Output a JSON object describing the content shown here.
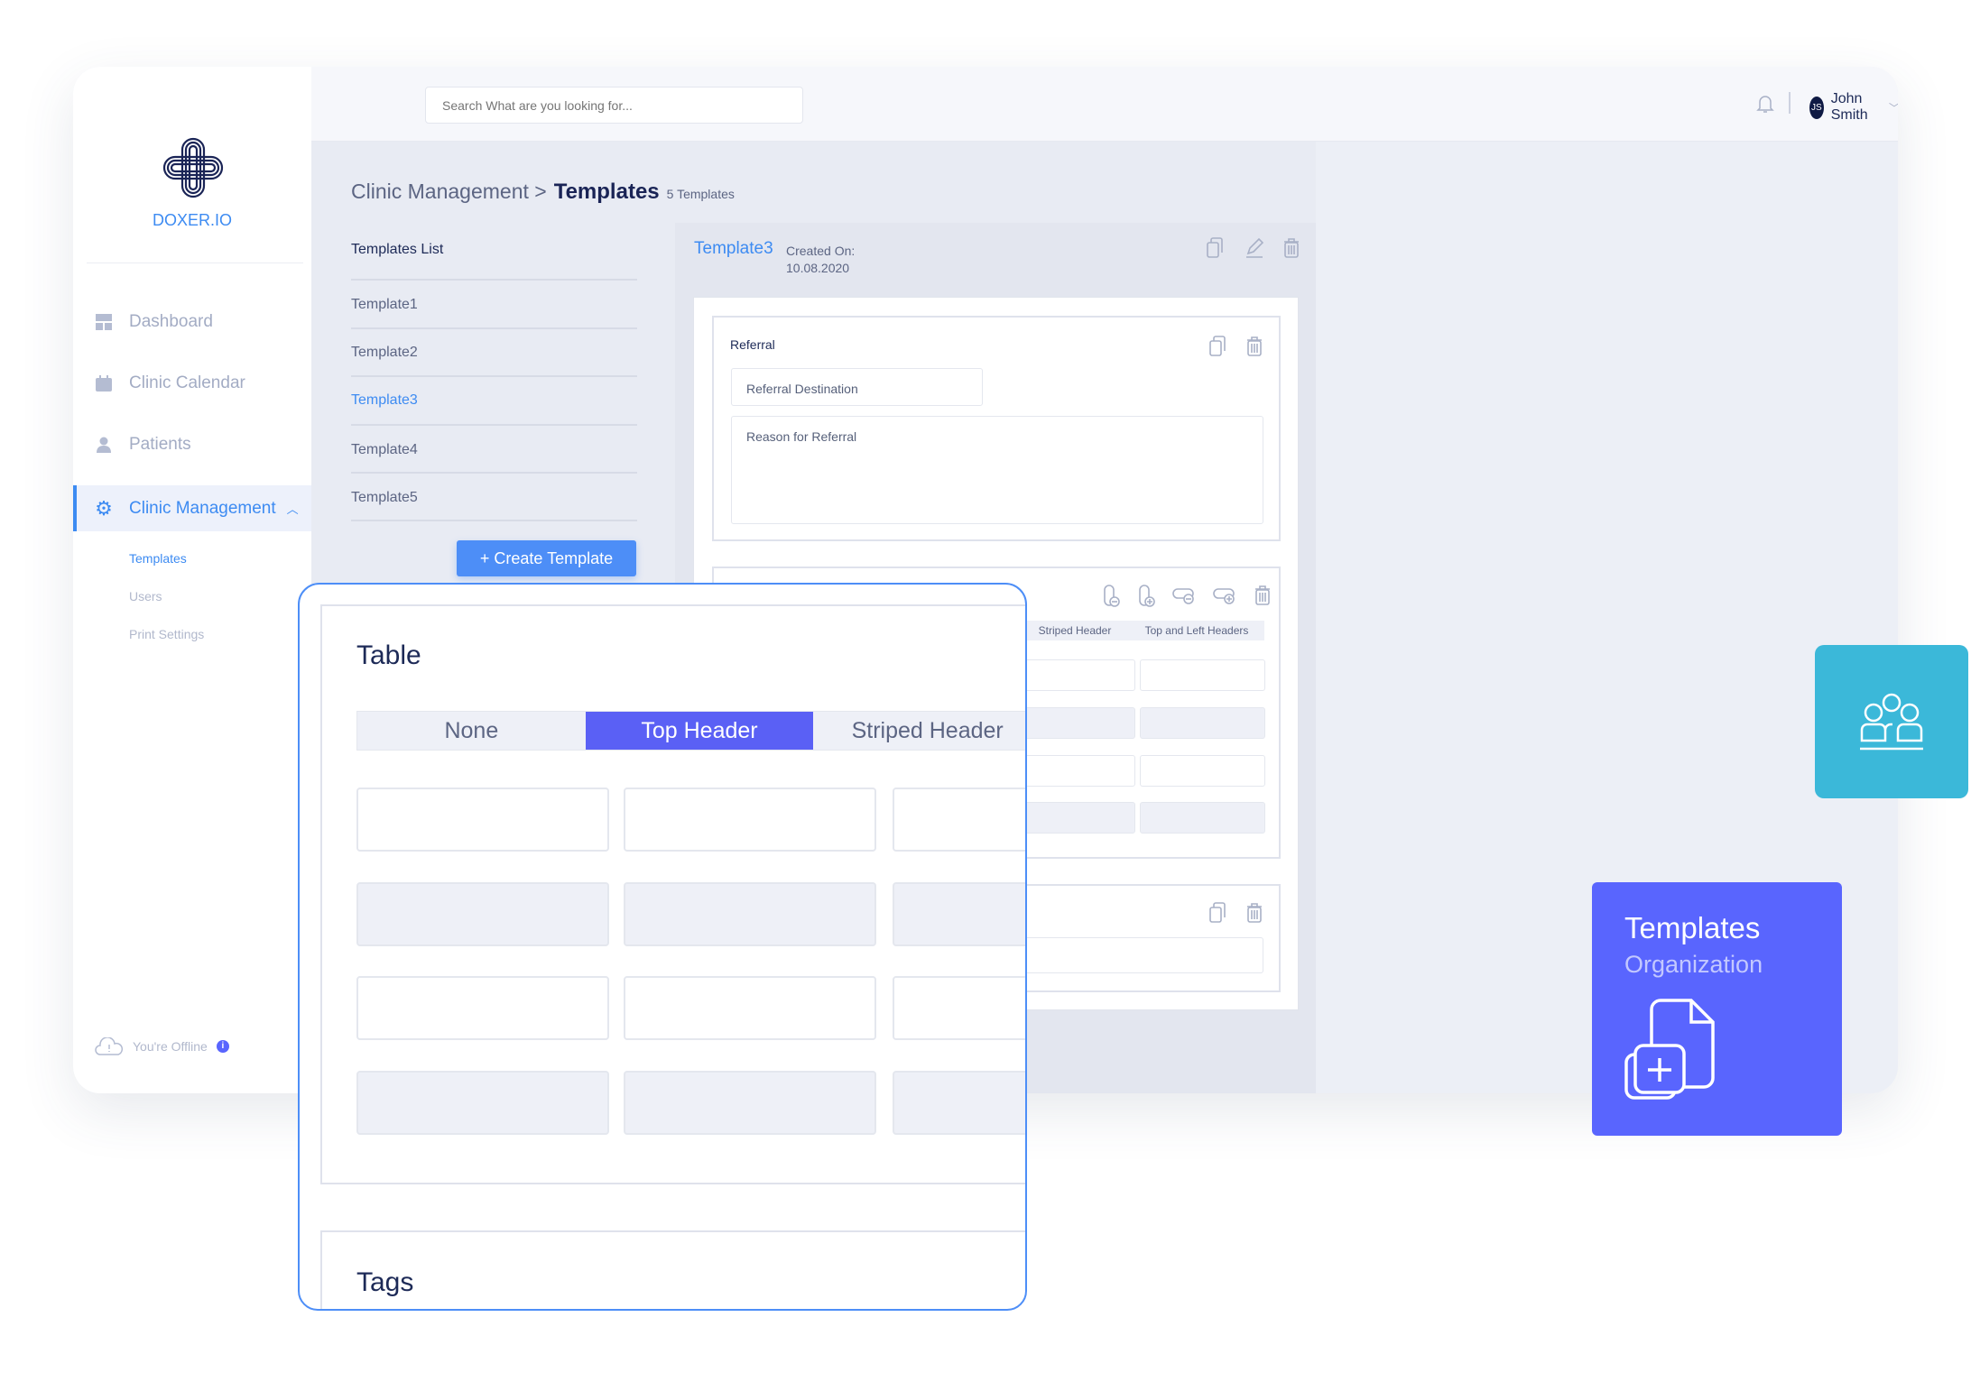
{
  "app": {
    "brand": "DOXER.IO"
  },
  "header": {
    "search_placeholder": "Search What are you looking for...",
    "user_initials": "JS",
    "user_name": "John Smith"
  },
  "sidebar": {
    "items": [
      {
        "label": "Dashboard",
        "icon": "dashboard-icon"
      },
      {
        "label": "Clinic Calendar",
        "icon": "calendar-icon"
      },
      {
        "label": "Patients",
        "icon": "user-icon"
      },
      {
        "label": "Clinic Management",
        "icon": "gear-icon",
        "active": true
      }
    ],
    "subitems": [
      {
        "label": "Templates",
        "active": true
      },
      {
        "label": "Users"
      },
      {
        "label": "Print Settings"
      }
    ],
    "status": "You're Offline"
  },
  "breadcrumb": {
    "parent": "Clinic Management >",
    "current": "Templates",
    "count": "5 Templates"
  },
  "templates_list": {
    "title": "Templates List",
    "items": [
      "Template1",
      "Template2",
      "Template3",
      "Template4",
      "Template5"
    ],
    "selected": "Template3",
    "create_label": "+ Create Template"
  },
  "detail": {
    "title": "Template3",
    "created_label": "Created On:",
    "created_date": "10.08.2020",
    "referral": {
      "title": "Referral",
      "destination_placeholder": "Referral Destination",
      "reason_placeholder": "Reason for Referral"
    },
    "table_tabs": [
      "Striped Header",
      "Top and Left Headers"
    ]
  },
  "overlay": {
    "title": "Table",
    "tabs": [
      "None",
      "Top Header",
      "Striped Header"
    ],
    "active_tab": "Top Header",
    "tags_title": "Tags"
  },
  "promo": {
    "title": "Templates",
    "subtitle": "Organization"
  },
  "colors": {
    "accent": "#3d8bf2",
    "active_tab": "#5a60f5",
    "promo": "#5965fe",
    "teal": "#3bb8d9",
    "navy": "#1a2456"
  }
}
